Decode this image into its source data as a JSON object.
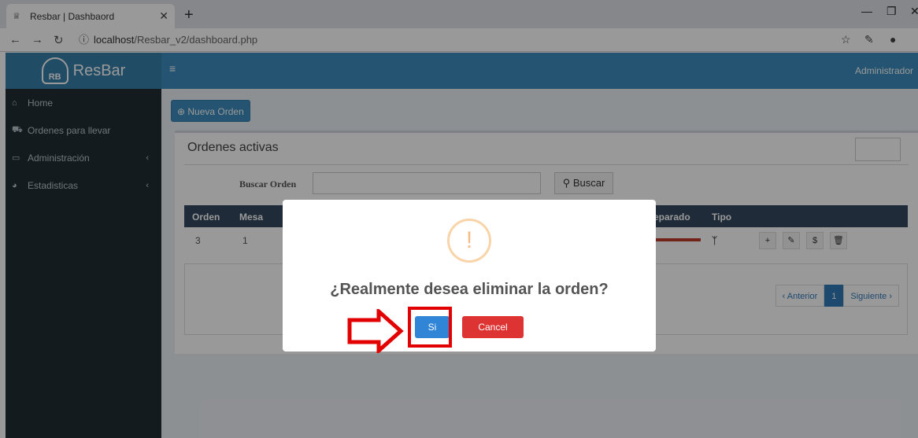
{
  "browser": {
    "tab_title": "Resbar | Dashbaord",
    "new_tab": "+",
    "url_host": "localhost",
    "url_path": "/Resbar_v2/dashboard.php"
  },
  "app": {
    "brand": "ResBar",
    "logo_text": "RB",
    "user": "Administrador",
    "sidebar": [
      {
        "label": "Home",
        "icon": "home-icon"
      },
      {
        "label": "Ordenes para llevar",
        "icon": "car-icon"
      },
      {
        "label": "Administración",
        "icon": "laptop-icon"
      },
      {
        "label": "Estadisticas",
        "icon": "chart-icon"
      }
    ]
  },
  "main": {
    "new_order_label": "Nueva Orden",
    "box_title": "Ordenes activas",
    "search_label": "Buscar Orden",
    "search_button": "Buscar",
    "columns": [
      "Orden",
      "Mesa",
      "eparado",
      "Tipo"
    ],
    "row": {
      "orden": "3",
      "mesa": "1"
    },
    "row_actions": [
      "+",
      "✎",
      "$",
      "🗑"
    ],
    "pager": {
      "prev": "‹ Anterior",
      "page": "1",
      "next": "Siguiente ›"
    }
  },
  "modal": {
    "icon": "!",
    "question": "¿Realmente desea eliminar la orden?",
    "confirm": "Si",
    "cancel": "Cancel"
  },
  "colors": {
    "header": "#3c8dbc",
    "sidebar": "#222d32",
    "confirm": "#3085d6",
    "cancel": "#dd3333",
    "annotation": "#e30000"
  }
}
